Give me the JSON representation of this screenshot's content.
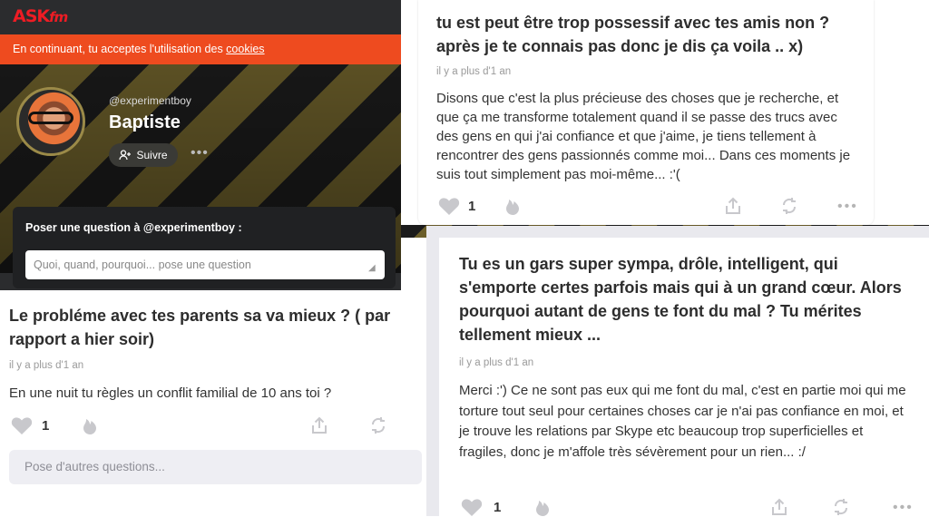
{
  "brand": {
    "logo_main": "ASK",
    "logo_suffix": "fm"
  },
  "cookie_bar": {
    "text": "En continuant, tu acceptes l'utilisation des ",
    "link": "cookies"
  },
  "profile": {
    "username": "@experimentboy",
    "display_name": "Baptiste",
    "follow_label": "Suivre",
    "more": "•••"
  },
  "ask": {
    "label": "Poser une question à @experimentboy :",
    "placeholder": "Quoi, quand, pourquoi... pose une question"
  },
  "more_questions_placeholder": "Pose d'autres questions...",
  "cards": [
    {
      "question": "tu est peut être trop possessif avec tes amis non ? après je te connais pas donc je dis ça voila .. x)",
      "time": "il y a plus d'1 an",
      "answer": "Disons que c'est la plus précieuse des choses que je recherche, et que ça me transforme totalement quand il se passe des trucs avec des gens en qui j'ai confiance et que j'aime, je tiens tellement à rencontrer des gens passionnés comme moi... Dans ces moments je suis tout simplement pas moi-même... :'(",
      "likes": "1"
    },
    {
      "question": "Le probléme avec tes parents sa va mieux ? ( par rapport a hier soir)",
      "time": "il y a plus d'1 an",
      "answer": "En une nuit tu règles un conflit familial de 10 ans toi ?",
      "likes": "1"
    },
    {
      "question": "Tu es un gars super sympa, drôle, intelligent, qui s'emporte certes parfois mais qui à un grand cœur. Alors pourquoi autant de gens te font du mal ? Tu mérites tellement mieux ...",
      "time": "il y a plus d'1 an",
      "answer": "Merci :') Ce ne sont pas eux qui me font du mal, c'est en partie moi qui me torture tout seul pour certaines choses car je n'ai pas confiance en moi, et je trouve les relations par Skype etc beaucoup trop superficielles et fragiles, donc je m'affole très sévèrement pour un rien... :/",
      "likes": "1"
    }
  ],
  "colors": {
    "brand_red": "#ee1c24",
    "cookie_orange": "#ee4b1f"
  }
}
